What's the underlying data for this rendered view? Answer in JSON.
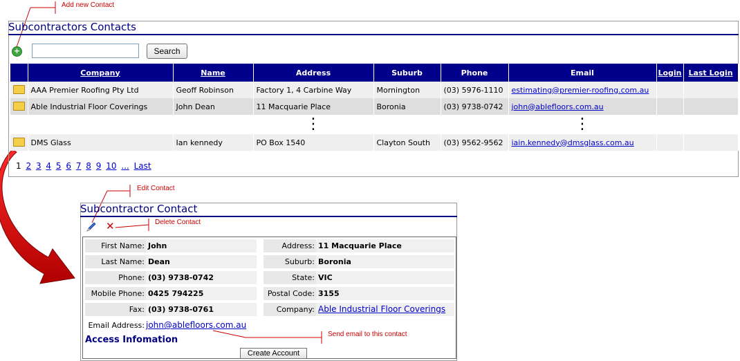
{
  "annotations": {
    "add_new_contact": "Add new Contact",
    "edit_contact": "Edit Contact",
    "delete_contact": "Delete Contact",
    "send_email": "Send email to this contact"
  },
  "list_panel": {
    "title": "Subcontractors Contacts",
    "add_icon": "plus-circle-icon",
    "search": {
      "value": "",
      "placeholder": "",
      "button_label": "Search"
    },
    "columns": [
      "Company",
      "Name",
      "Address",
      "Suburb",
      "Phone",
      "Email",
      "Login",
      "Last Login"
    ],
    "rows": [
      {
        "company": "AAA Premier Roofing Pty Ltd",
        "name": "Geoff Robinson",
        "address": "Factory 1, 4 Carbine Way",
        "suburb": "Mornington",
        "phone": "(03) 5976-1110",
        "email": "estimating@premier-roofing.com.au",
        "login": "",
        "last_login": ""
      },
      {
        "company": "Able Industrial Floor Coverings",
        "name": "John Dean",
        "address": "11 Macquarie Place",
        "suburb": "Boronia",
        "phone": "(03) 9738-0742",
        "email": "john@ablefloors.com.au",
        "login": "",
        "last_login": ""
      },
      {
        "company": "DMS Glass",
        "name": "Ian kennedy",
        "address": "PO Box 1540",
        "suburb": "Clayton South",
        "phone": "(03) 9562-9562",
        "email": "iain.kennedy@dmsglass.com.au",
        "login": "",
        "last_login": ""
      }
    ],
    "ellipsis": "⋮",
    "pager": {
      "current": "1",
      "pages": [
        "2",
        "3",
        "4",
        "5",
        "6",
        "7",
        "8",
        "9",
        "10"
      ],
      "more": "...",
      "last": "Last"
    }
  },
  "detail_panel": {
    "title": "Subcontractor Contact",
    "edit_icon": "pencil-icon",
    "delete_icon": "x-icon",
    "left_fields": [
      {
        "label": "First Name:",
        "value": "John"
      },
      {
        "label": "Last Name:",
        "value": "Dean"
      },
      {
        "label": "Phone:",
        "value": "(03) 9738-0742"
      },
      {
        "label": "Mobile Phone:",
        "value": "0425 794225"
      },
      {
        "label": "Fax:",
        "value": "(03) 9738-0761"
      }
    ],
    "right_fields": [
      {
        "label": "Address:",
        "value": "11 Macquarie Place"
      },
      {
        "label": "Suburb:",
        "value": "Boronia"
      },
      {
        "label": "State:",
        "value": "VIC"
      },
      {
        "label": "Postal Code:",
        "value": "3155"
      },
      {
        "label": "Company:",
        "value": "Able Industrial Floor Coverings"
      }
    ],
    "email_label": "Email Address:",
    "email_value": "john@ablefloors.com.au",
    "access_title": "Access Infomation",
    "create_account_label": "Create Account"
  },
  "colors": {
    "header_bg": "#00008b",
    "title": "#000080",
    "annotation": "#cc0000",
    "link": "#0000cc"
  }
}
